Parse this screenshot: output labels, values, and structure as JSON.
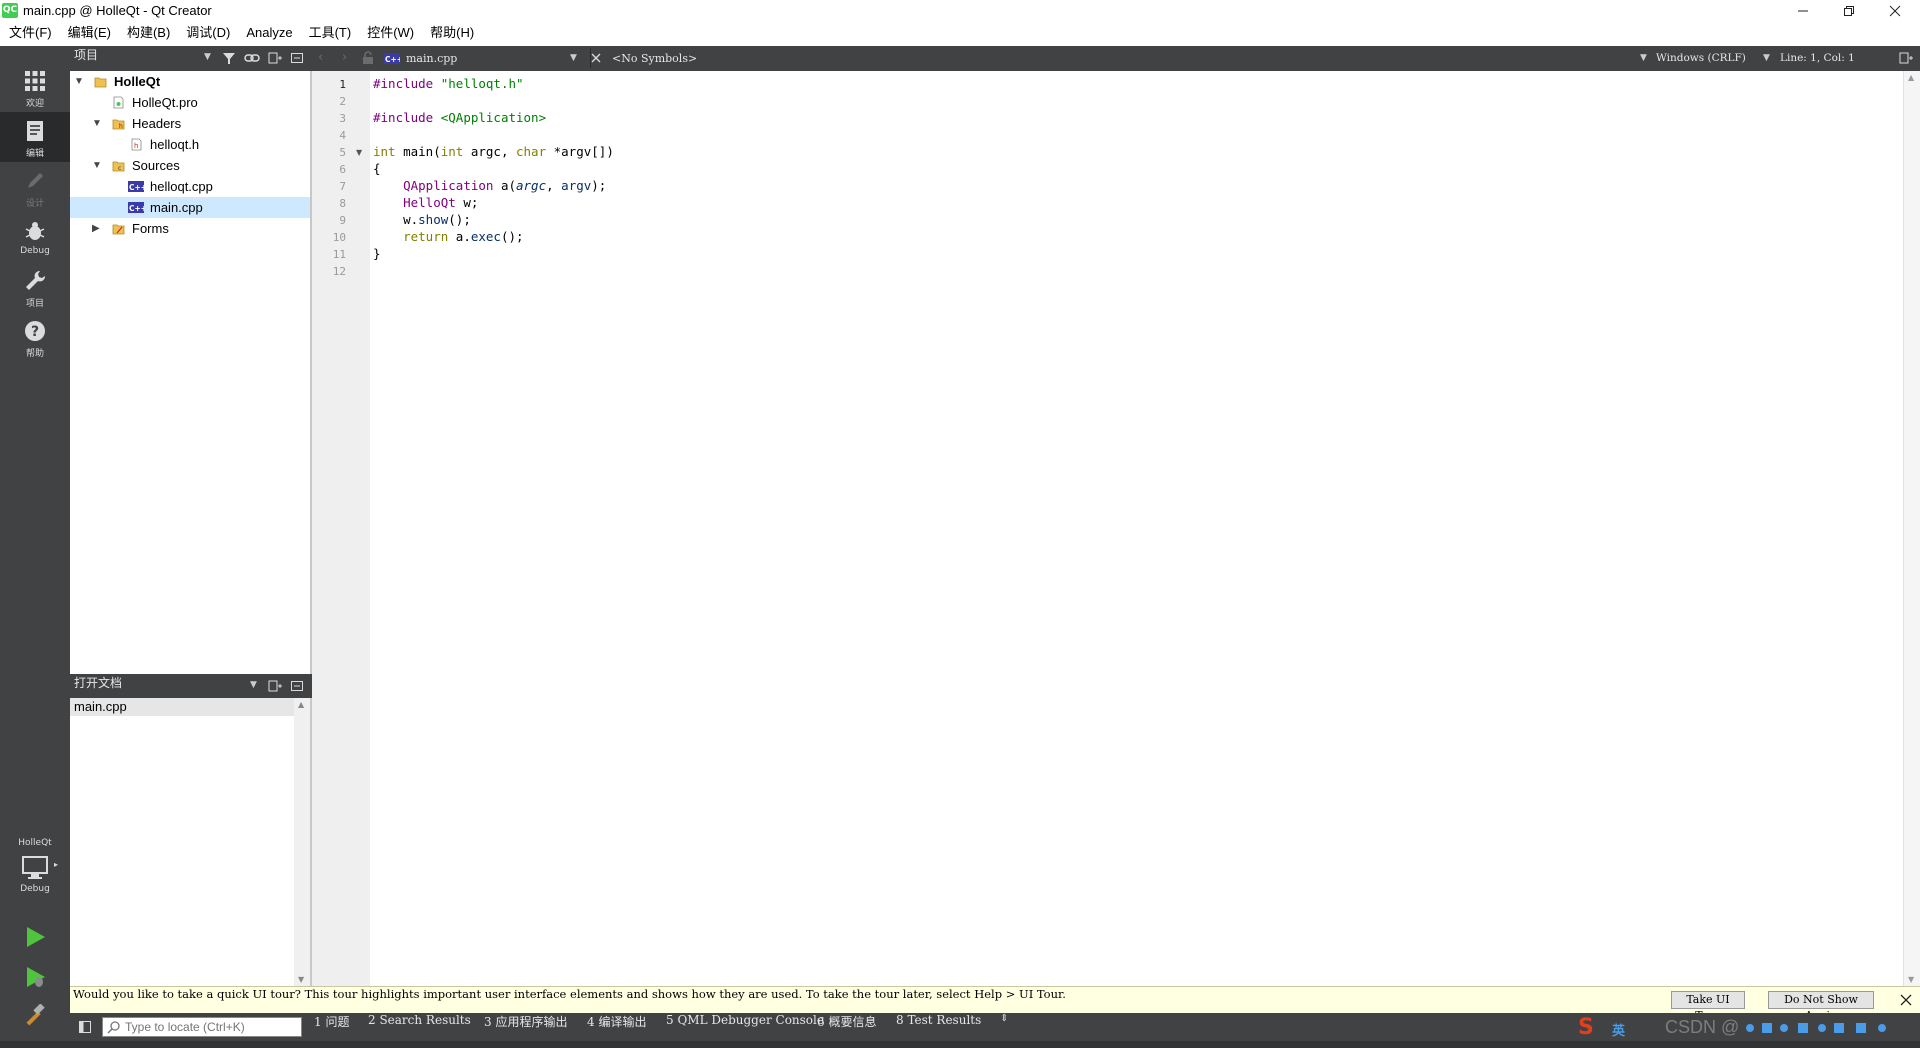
{
  "window": {
    "title": "main.cpp @ HolleQt - Qt Creator",
    "logo_text": "QC"
  },
  "menu": [
    "文件(F)",
    "编辑(E)",
    "构建(B)",
    "调试(D)",
    "Analyze",
    "工具(T)",
    "控件(W)",
    "帮助(H)"
  ],
  "modes": [
    {
      "label": "欢迎",
      "icon": "grid-icon"
    },
    {
      "label": "编辑",
      "icon": "edit-icon"
    },
    {
      "label": "设计",
      "icon": "pencil-icon"
    },
    {
      "label": "Debug",
      "icon": "bug-icon"
    },
    {
      "label": "项目",
      "icon": "wrench-icon"
    },
    {
      "label": "帮助",
      "icon": "help-icon"
    }
  ],
  "kit": {
    "project": "HolleQt",
    "config": "Debug"
  },
  "project_panel": {
    "title": "项目"
  },
  "tree": {
    "root": "HolleQt",
    "pro_file": "HolleQt.pro",
    "headers": "Headers",
    "header_file": "helloqt.h",
    "sources": "Sources",
    "source_file_1": "helloqt.cpp",
    "source_file_2": "main.cpp",
    "forms": "Forms"
  },
  "open_docs": {
    "title": "打开文档",
    "items": [
      "main.cpp"
    ]
  },
  "editor_toolbar": {
    "file": "main.cpp",
    "symbols": "<No Symbols>",
    "line_ending": "Windows (CRLF)",
    "position": "Line: 1, Col: 1"
  },
  "code": {
    "line_numbers": [
      "1",
      "2",
      "3",
      "4",
      "5",
      "6",
      "7",
      "8",
      "9",
      "10",
      "11",
      "12"
    ],
    "current_line": 1
  },
  "tour": {
    "message": "Would you like to take a quick UI tour? This tour highlights important user interface elements and shows how they are used. To take the tour later, select Help > UI Tour.",
    "take_label": "Take UI Tour",
    "dismiss_label": "Do Not Show Again"
  },
  "locator": {
    "placeholder": "Type to locate (Ctrl+K)"
  },
  "output_tabs": [
    "1  问题",
    "2  Search Results",
    "3  应用程序输出",
    "4  编译输出",
    "5  QML Debugger Console",
    "6  概要信息",
    "8  Test Results"
  ],
  "tray": {
    "ime_label": "英",
    "watermark": "CSDN @"
  },
  "colors": {
    "sidebar": "#404244",
    "selection": "#cde8ff",
    "keyword": "#808000",
    "string": "#008000",
    "type": "#800080",
    "banner": "#ffffe1"
  }
}
